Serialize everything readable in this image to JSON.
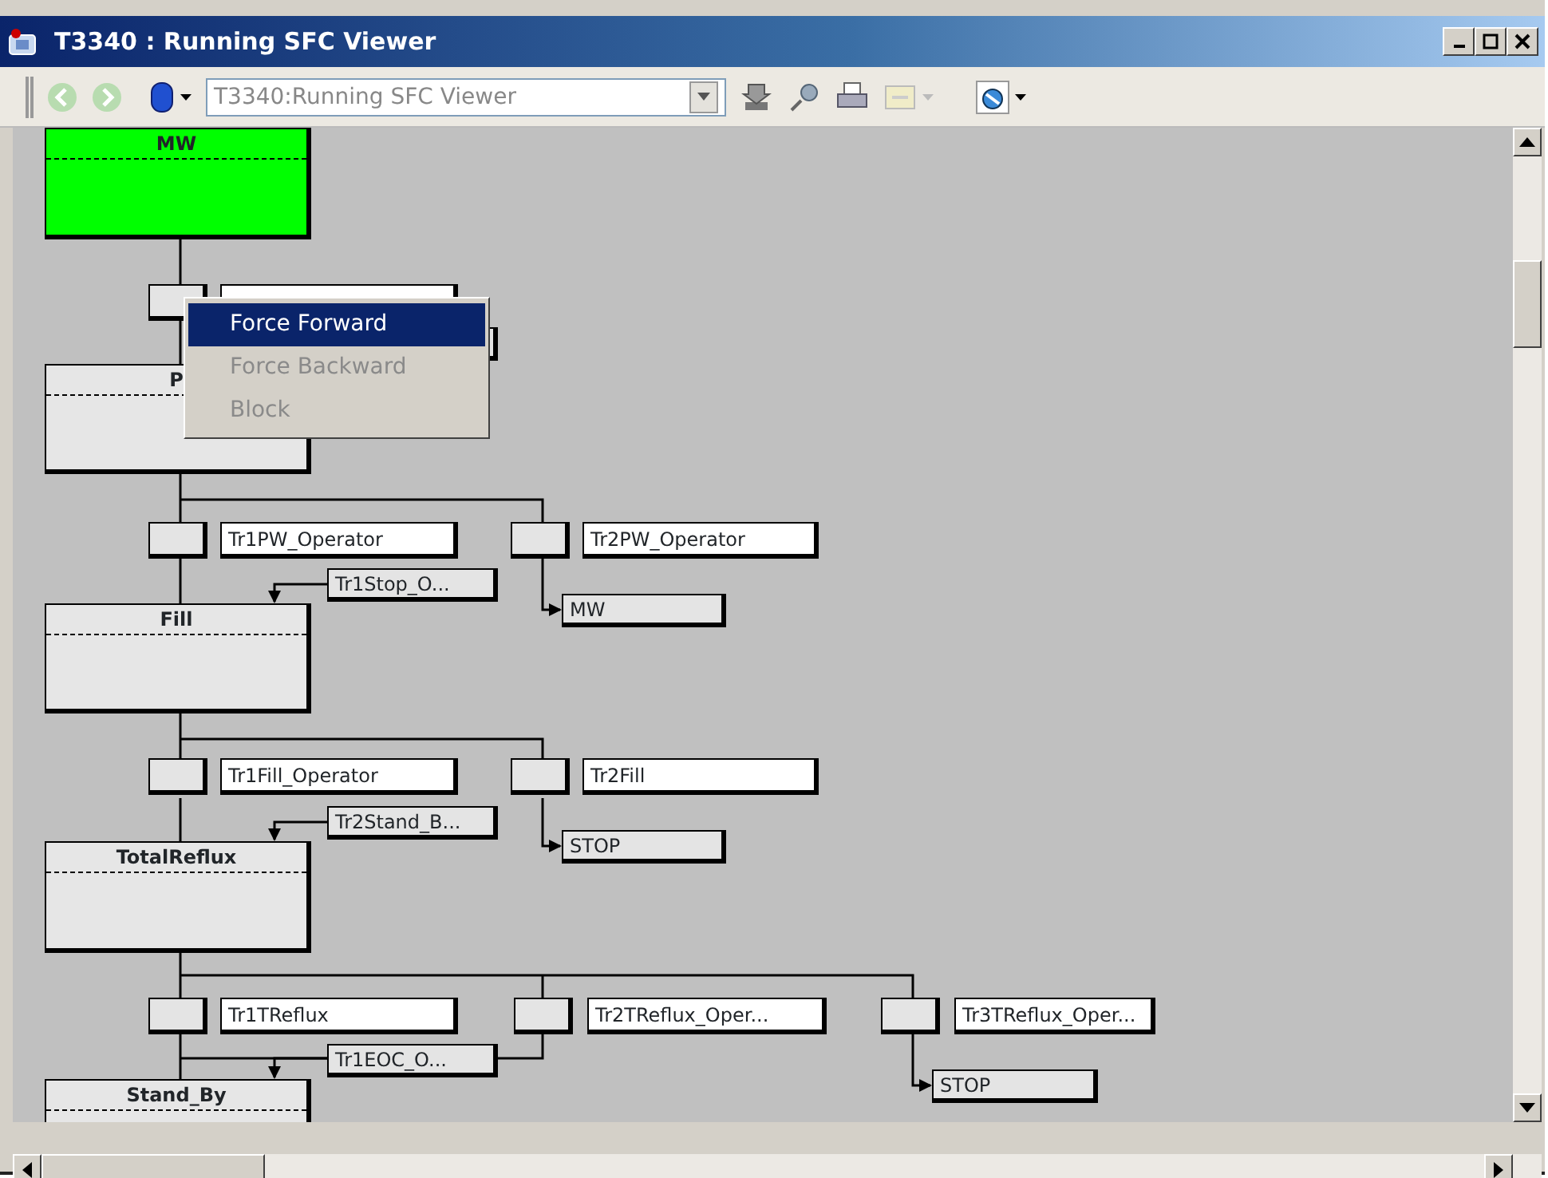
{
  "window": {
    "title": "T3340 : Running SFC Viewer"
  },
  "toolbar": {
    "address": "T3340:Running SFC Viewer"
  },
  "diagram": {
    "steps": [
      {
        "name": "MW",
        "active": true
      },
      {
        "name": "P",
        "active": false
      },
      {
        "name": "Fill",
        "active": false
      },
      {
        "name": "TotalReflux",
        "active": false
      },
      {
        "name": "Stand_By",
        "active": false
      }
    ],
    "transitions": [
      {
        "kind": "covered"
      },
      {
        "label": "Tr1PW_Operator"
      },
      {
        "label": "Tr2PW_Operator"
      },
      {
        "label": "Tr1Fill_Operator"
      },
      {
        "label": "Tr2Fill"
      },
      {
        "label": "Tr1TReflux"
      },
      {
        "label": "Tr2TReflux_Oper..."
      },
      {
        "label": "Tr3TReflux_Oper..."
      }
    ],
    "incoming": [
      {
        "kind": "covered"
      },
      {
        "label": "Tr1Stop_O..."
      },
      {
        "label": "Tr2Stand_B..."
      },
      {
        "label": "Tr1EOC_O..."
      }
    ],
    "jumps": [
      {
        "label": "MW"
      },
      {
        "label": "STOP"
      },
      {
        "label": "STOP"
      }
    ]
  },
  "context_menu": {
    "items": [
      {
        "label": "Force Forward",
        "selected": true,
        "disabled": false
      },
      {
        "label": "Force Backward",
        "selected": false,
        "disabled": true
      },
      {
        "label": "Block",
        "selected": false,
        "disabled": true
      }
    ]
  }
}
